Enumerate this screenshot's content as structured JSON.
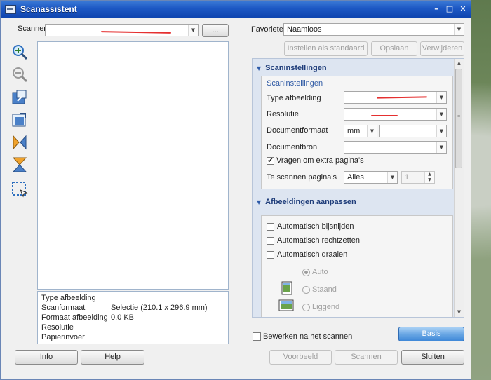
{
  "window": {
    "title": "Scanassistent",
    "icon": "scanner-app-icon"
  },
  "scanner": {
    "label": "Scanner",
    "value": "",
    "more_button": "..."
  },
  "favorites": {
    "label": "Favorieten",
    "value": "Naamloos",
    "buttons": {
      "set_default": "Instellen als standaard",
      "save": "Opslaan",
      "delete": "Verwijderen"
    }
  },
  "toolbar": [
    "zoom-in-icon",
    "zoom-out-icon",
    "fit-page-icon",
    "actual-size-icon",
    "flip-icon",
    "rotate-icon",
    "select-area-icon"
  ],
  "info": {
    "rows": [
      {
        "label": "Type afbeelding",
        "value": ""
      },
      {
        "label": "Scanformaat",
        "value": "Selectie (210.1 x 296.9 mm)"
      },
      {
        "label": "Formaat afbeelding",
        "value": "0.0 KB"
      },
      {
        "label": "Resolutie",
        "value": ""
      },
      {
        "label": "Papierinvoer",
        "value": ""
      }
    ]
  },
  "scan_settings": {
    "heading": "Scaninstellingen",
    "group_title": "Scaninstellingen",
    "type_label": "Type afbeelding",
    "type_value": "",
    "resolution_label": "Resolutie",
    "resolution_value": "",
    "doc_format_label": "Documentformaat",
    "doc_format_unit": "mm",
    "doc_format_value": "",
    "doc_source_label": "Documentbron",
    "doc_source_value": "",
    "ask_more_pages_label": "Vragen om extra pagina's",
    "ask_more_pages_checked": true,
    "pages_label": "Te scannen pagina's",
    "pages_value": "Alles",
    "pages_count": "1"
  },
  "image_adjust": {
    "heading": "Afbeeldingen aanpassen",
    "auto_crop": "Automatisch bijsnijden",
    "auto_straighten": "Automatisch rechtzetten",
    "auto_rotate": "Automatisch draaien",
    "orientation": {
      "auto": "Auto",
      "portrait": "Staand",
      "landscape": "Liggend",
      "selected": "Auto"
    }
  },
  "footer": {
    "edit_after_scan": "Bewerken na het scannen",
    "basis": "Basis",
    "info": "Info",
    "help": "Help",
    "preview": "Voorbeeld",
    "scan": "Scannen",
    "close": "Sluiten"
  },
  "colors": {
    "titlebar": "#1d58c4",
    "panel": "#dde5f1",
    "accent_button": "#3f88d8",
    "heading": "#1f3d7a"
  }
}
